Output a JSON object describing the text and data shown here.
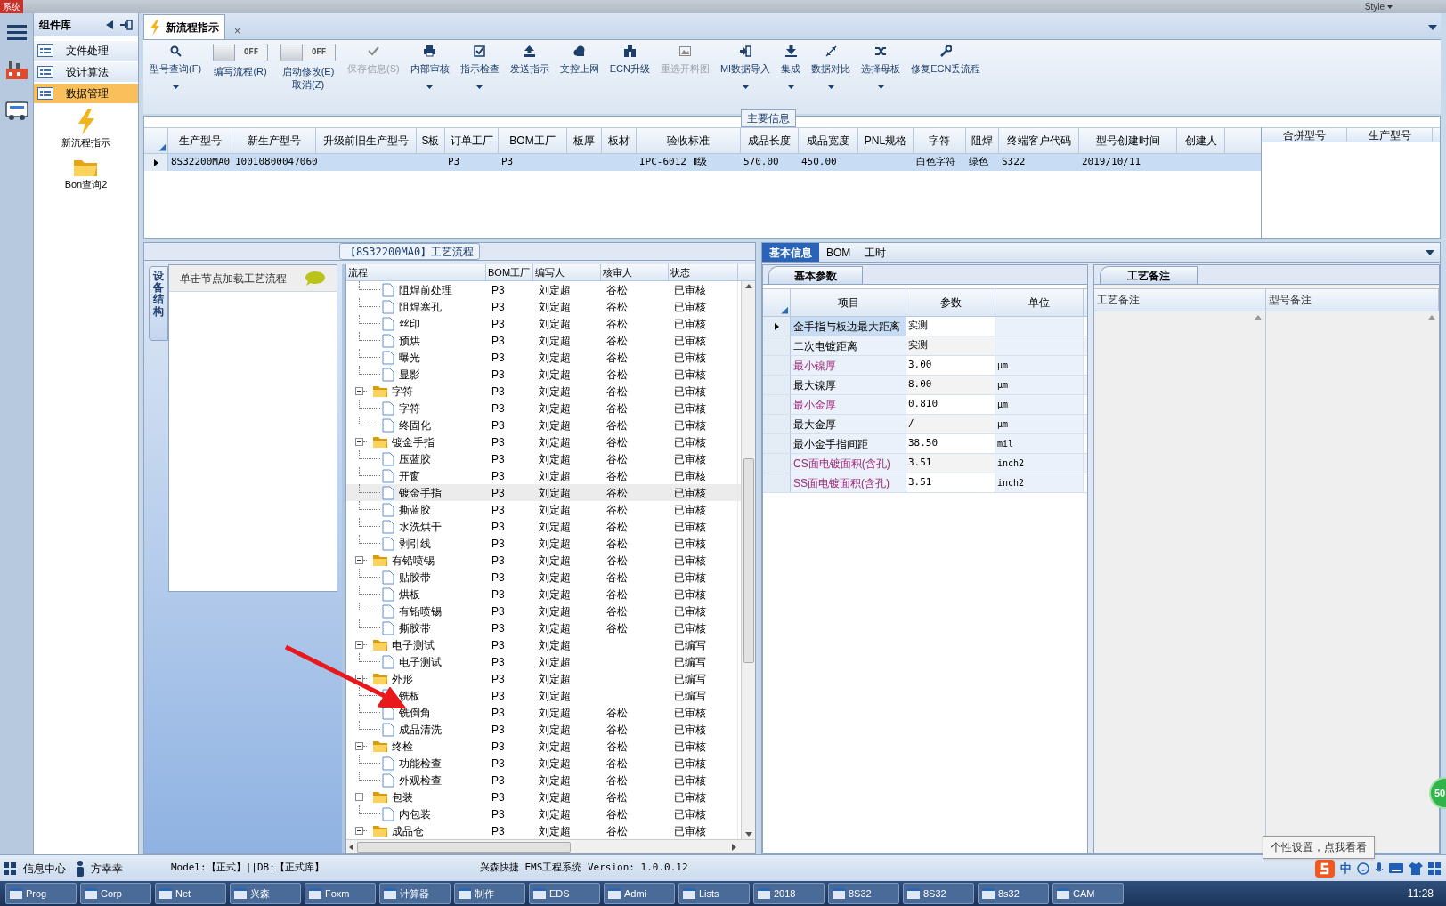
{
  "title_bar": {
    "system_menu": "系统",
    "style_menu": "Style"
  },
  "sidebar": {
    "title": "组件库",
    "items": [
      {
        "label": "文件处理",
        "selected": false
      },
      {
        "label": "设计算法",
        "selected": false
      },
      {
        "label": "数据管理",
        "selected": true
      }
    ],
    "shortcuts": [
      {
        "label": "新流程指示",
        "kind": "flash"
      },
      {
        "label": "Bon查询2",
        "kind": "folder"
      }
    ]
  },
  "document_tab": {
    "label": "新流程指示",
    "close": "×"
  },
  "toolbar": [
    {
      "kind": "button",
      "label": "型号查询(F)",
      "dropdown": true,
      "disabled": false
    },
    {
      "kind": "toggle",
      "label": "编写流程(R)",
      "state_text": "OFF",
      "on": false
    },
    {
      "kind": "toggle",
      "label": "启动修改(E)",
      "label2": "取消(Z)",
      "state_text": "OFF",
      "on": false
    },
    {
      "kind": "button",
      "label": "保存信息(S)",
      "dropdown": false,
      "disabled": true
    },
    {
      "kind": "button",
      "label": "内部审核",
      "dropdown": true,
      "disabled": false
    },
    {
      "kind": "button",
      "label": "指示检查",
      "dropdown": true,
      "disabled": false
    },
    {
      "kind": "button",
      "label": "发送指示",
      "dropdown": false,
      "disabled": false
    },
    {
      "kind": "button",
      "label": "文控上网",
      "dropdown": false,
      "disabled": false
    },
    {
      "kind": "button",
      "label": "ECN升级",
      "dropdown": false,
      "disabled": false
    },
    {
      "kind": "button",
      "label": "重选开料图",
      "dropdown": false,
      "disabled": true
    },
    {
      "kind": "button",
      "label": "MI数据导入",
      "dropdown": true,
      "disabled": false
    },
    {
      "kind": "button",
      "label": "集成",
      "dropdown": true,
      "disabled": false
    },
    {
      "kind": "button",
      "label": "数据对比",
      "dropdown": true,
      "disabled": false
    },
    {
      "kind": "button",
      "label": "选择母板",
      "dropdown": true,
      "disabled": false
    },
    {
      "kind": "button",
      "label": "修复ECN丢流程",
      "dropdown": false,
      "disabled": false
    }
  ],
  "main_info": {
    "title": "主要信息",
    "columns": [
      "生产型号",
      "新生产型号",
      "升级前旧生产型号",
      "S板",
      "订单工厂",
      "BOM工厂",
      "板厚",
      "板材",
      "验收标准",
      "成品长度",
      "成品宽度",
      "PNL规格",
      "字符",
      "阻焊",
      "终端客户代码",
      "型号创建时间",
      "创建人"
    ],
    "rows": [
      {
        "selected": true,
        "cells": [
          "8S32200MA0",
          "10010800047060",
          null,
          null,
          "P3",
          "P3",
          null,
          null,
          "IPC-6012 Ⅱ级",
          "570.00",
          "450.00",
          null,
          "白色字符",
          "绿色",
          "S322",
          "2019/10/11",
          null
        ]
      }
    ],
    "side_columns": [
      "合拼型号",
      "生产型号"
    ]
  },
  "process": {
    "title": "【8S32200MA0】工艺流程",
    "side_tab": "设备结构",
    "hint": "单击节点加载工艺流程",
    "columns": [
      "流程",
      "BOM工厂",
      "编写人",
      "核审人",
      "状态"
    ],
    "tree": [
      {
        "children": [
          {
            "label": "阻焊前处理",
            "bom": "P3",
            "writer": "刘定超",
            "reviewer": "谷松",
            "status": "已审核",
            "selected": false
          },
          {
            "label": "阻焊塞孔",
            "bom": "P3",
            "writer": "刘定超",
            "reviewer": "谷松",
            "status": "已审核",
            "selected": false
          },
          {
            "label": "丝印",
            "bom": "P3",
            "writer": "刘定超",
            "reviewer": "谷松",
            "status": "已审核",
            "selected": false
          },
          {
            "label": "预烘",
            "bom": "P3",
            "writer": "刘定超",
            "reviewer": "谷松",
            "status": "已审核",
            "selected": false
          },
          {
            "label": "曝光",
            "bom": "P3",
            "writer": "刘定超",
            "reviewer": "谷松",
            "status": "已审核",
            "selected": false
          },
          {
            "label": "显影",
            "bom": "P3",
            "writer": "刘定超",
            "reviewer": "谷松",
            "status": "已审核",
            "selected": false
          }
        ]
      },
      {
        "label": "字符",
        "bom": "P3",
        "writer": "刘定超",
        "reviewer": "谷松",
        "status": "已审核",
        "selected": false,
        "expanded": true,
        "children": [
          {
            "label": "字符",
            "bom": "P3",
            "writer": "刘定超",
            "reviewer": "谷松",
            "status": "已审核",
            "selected": false
          },
          {
            "label": "终固化",
            "bom": "P3",
            "writer": "刘定超",
            "reviewer": "谷松",
            "status": "已审核",
            "selected": false
          }
        ]
      },
      {
        "label": "镀金手指",
        "bom": "P3",
        "writer": "刘定超",
        "reviewer": "谷松",
        "status": "已审核",
        "selected": false,
        "expanded": true,
        "children": [
          {
            "label": "压蓝胶",
            "bom": "P3",
            "writer": "刘定超",
            "reviewer": "谷松",
            "status": "已审核",
            "selected": false
          },
          {
            "label": "开窗",
            "bom": "P3",
            "writer": "刘定超",
            "reviewer": "谷松",
            "status": "已审核",
            "selected": false
          },
          {
            "label": "镀金手指",
            "bom": "P3",
            "writer": "刘定超",
            "reviewer": "谷松",
            "status": "已审核",
            "selected": true
          },
          {
            "label": "撕蓝胶",
            "bom": "P3",
            "writer": "刘定超",
            "reviewer": "谷松",
            "status": "已审核",
            "selected": false
          },
          {
            "label": "水洗烘干",
            "bom": "P3",
            "writer": "刘定超",
            "reviewer": "谷松",
            "status": "已审核",
            "selected": false
          },
          {
            "label": "剥引线",
            "bom": "P3",
            "writer": "刘定超",
            "reviewer": "谷松",
            "status": "已审核",
            "selected": false
          }
        ]
      },
      {
        "label": "有铅喷锡",
        "bom": "P3",
        "writer": "刘定超",
        "reviewer": "谷松",
        "status": "已审核",
        "selected": false,
        "expanded": true,
        "children": [
          {
            "label": "贴胶带",
            "bom": "P3",
            "writer": "刘定超",
            "reviewer": "谷松",
            "status": "已审核",
            "selected": false
          },
          {
            "label": "烘板",
            "bom": "P3",
            "writer": "刘定超",
            "reviewer": "谷松",
            "status": "已审核",
            "selected": false
          },
          {
            "label": "有铅喷锡",
            "bom": "P3",
            "writer": "刘定超",
            "reviewer": "谷松",
            "status": "已审核",
            "selected": false
          },
          {
            "label": "撕胶带",
            "bom": "P3",
            "writer": "刘定超",
            "reviewer": "谷松",
            "status": "已审核",
            "selected": false
          }
        ]
      },
      {
        "label": "电子测试",
        "bom": "P3",
        "writer": "刘定超",
        "status": "已编写",
        "selected": false,
        "expanded": true,
        "children": [
          {
            "label": "电子测试",
            "bom": "P3",
            "writer": "刘定超",
            "status": "已编写",
            "selected": false
          }
        ]
      },
      {
        "label": "外形",
        "bom": "P3",
        "writer": "刘定超",
        "status": "已编写",
        "selected": false,
        "expanded": true,
        "children": [
          {
            "label": "铣板",
            "bom": "P3",
            "writer": "刘定超",
            "status": "已编写",
            "selected": false
          },
          {
            "label": "铣倒角",
            "bom": "P3",
            "writer": "刘定超",
            "reviewer": "谷松",
            "status": "已审核",
            "selected": false
          },
          {
            "label": "成品清洗",
            "bom": "P3",
            "writer": "刘定超",
            "reviewer": "谷松",
            "status": "已审核",
            "selected": false
          }
        ]
      },
      {
        "label": "终检",
        "bom": "P3",
        "writer": "刘定超",
        "reviewer": "谷松",
        "status": "已审核",
        "selected": false,
        "expanded": true,
        "children": [
          {
            "label": "功能检查",
            "bom": "P3",
            "writer": "刘定超",
            "reviewer": "谷松",
            "status": "已审核",
            "selected": false
          },
          {
            "label": "外观检查",
            "bom": "P3",
            "writer": "刘定超",
            "reviewer": "谷松",
            "status": "已审核",
            "selected": false
          }
        ]
      },
      {
        "label": "包装",
        "bom": "P3",
        "writer": "刘定超",
        "reviewer": "谷松",
        "status": "已审核",
        "selected": false,
        "expanded": true,
        "children": [
          {
            "label": "内包装",
            "bom": "P3",
            "writer": "刘定超",
            "reviewer": "谷松",
            "status": "已审核",
            "selected": false
          }
        ]
      },
      {
        "label": "成品仓",
        "bom": "P3",
        "writer": "刘定超",
        "reviewer": "谷松",
        "status": "已审核",
        "selected": false,
        "expanded": true
      }
    ]
  },
  "detail": {
    "tabs": [
      {
        "label": "基本信息",
        "selected": true
      },
      {
        "label": "BOM",
        "selected": false
      },
      {
        "label": "工时",
        "selected": false
      }
    ],
    "params_tab": "基本参数",
    "columns": [
      "项目",
      "参数",
      "单位"
    ],
    "params": [
      {
        "item": "金手指与板边最大距离",
        "value": "实测",
        "selected": true,
        "highlighted": false
      },
      {
        "item": "二次电镀距离",
        "value": "实测",
        "selected": false,
        "highlighted": false
      },
      {
        "item": "最小镍厚",
        "value": "3.00",
        "unit": "μm",
        "selected": false,
        "highlighted": true
      },
      {
        "item": "最大镍厚",
        "value": "8.00",
        "unit": "μm",
        "selected": false,
        "highlighted": false
      },
      {
        "item": "最小金厚",
        "value": "0.810",
        "unit": "μm",
        "selected": false,
        "highlighted": true
      },
      {
        "item": "最大金厚",
        "value": "/",
        "unit": "μm",
        "selected": false,
        "highlighted": false
      },
      {
        "item": "最小金手指间距",
        "value": "38.50",
        "unit": "mil",
        "selected": false,
        "highlighted": false
      },
      {
        "item": "CS面电镀面积(含孔)",
        "value": "3.51",
        "unit": "inch2",
        "selected": false,
        "highlighted": true
      },
      {
        "item": "SS面电镀面积(含孔)",
        "value": "3.51",
        "unit": "inch2",
        "selected": false,
        "highlighted": true
      }
    ],
    "notes_tab": "工艺备注",
    "notes_columns": [
      "工艺备注",
      "型号备注"
    ]
  },
  "status_bar": {
    "info_center": "信息中心",
    "user": "方幸幸",
    "model": "Model:【正式】||DB:【正式库】",
    "app": "兴森快捷 EMS工程系统 Version: 1.0.0.12"
  },
  "tooltip": "个性设置，点我看看",
  "ime": {
    "mode": "中"
  },
  "side_badge": "50",
  "taskbar": {
    "items": [
      "Prog",
      "Corp",
      "Net",
      "兴森",
      "Foxm",
      "计算器",
      "制作",
      "EDS",
      "Admi",
      "Lists",
      "2018",
      "8S32",
      "8S32",
      "8s32",
      "CAM"
    ],
    "clock": "11:28"
  }
}
